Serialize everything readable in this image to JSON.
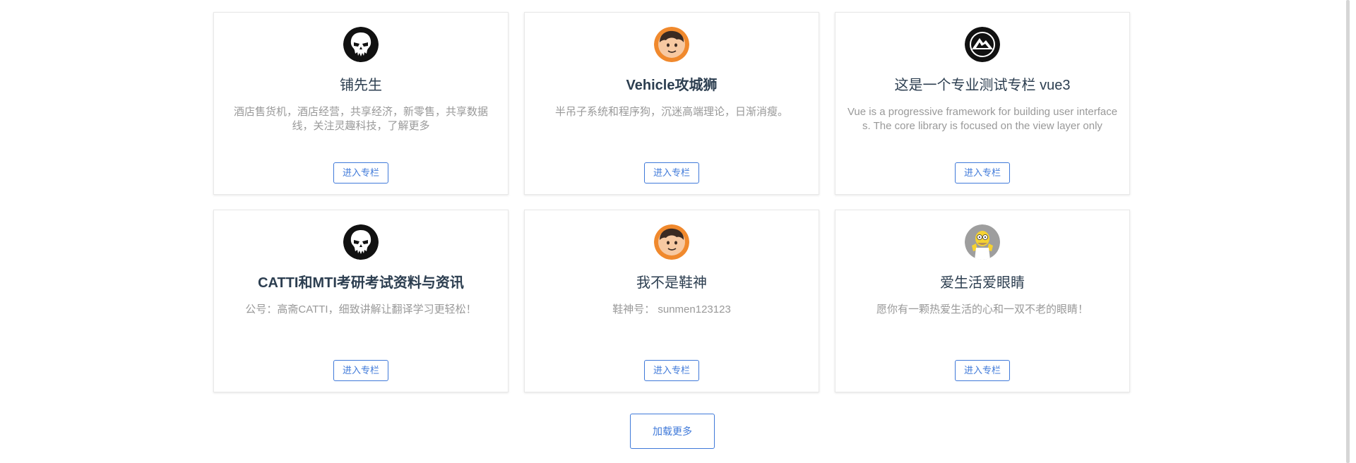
{
  "columns": [
    {
      "avatar_icon": "punisher-skull-icon",
      "title": "铺先生",
      "description": "酒店售货机，酒店经营，共享经济，新零售，共享数据线，关注灵趣科技，了解更多",
      "button_label": "进入专栏"
    },
    {
      "avatar_icon": "cartoon-boy-avatar-icon",
      "title": "Vehicle攻城狮",
      "description": "半吊子系统和程序狗，沉迷高端理论，日渐消瘦。",
      "button_label": "进入专栏"
    },
    {
      "avatar_icon": "mountain-logo-icon",
      "title": "这是一个专业测试专栏 vue3",
      "description": "Vue is a progressive framework for building user interfaces. The core library is focused on the view layer only",
      "button_label": "进入专栏"
    },
    {
      "avatar_icon": "punisher-skull-icon",
      "title": "CATTI和MTI考研考试资料与资讯",
      "description": "公号：高斋CATTI，细致讲解让翻译学习更轻松！",
      "button_label": "进入专栏"
    },
    {
      "avatar_icon": "cartoon-boy-avatar-icon",
      "title": "我不是鞋神",
      "description": "鞋神号： sunmen123123",
      "button_label": "进入专栏"
    },
    {
      "avatar_icon": "homer-simpson-avatar-icon",
      "title": "爱生活爱眼睛",
      "description": "愿你有一颗热爱生活的心和一双不老的眼睛！",
      "button_label": "进入专栏"
    }
  ],
  "load_more_label": "加载更多",
  "colors": {
    "accent": "#3f79d9",
    "title": "#2c3e50",
    "description": "#999999",
    "card_border": "#e8e8e8"
  }
}
